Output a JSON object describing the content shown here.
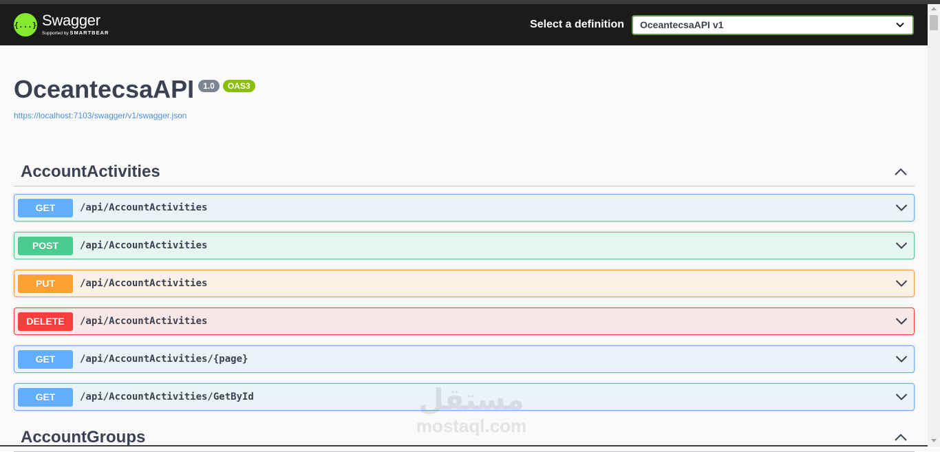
{
  "topbar": {
    "logo_name": "Swagger",
    "logo_sub_prefix": "Supported by",
    "logo_sub_brand": "SMARTBEAR",
    "logo_glyph": "{...}",
    "definition_label": "Select a definition",
    "definition_value": "OceantecsaAPI v1"
  },
  "info": {
    "title": "OceantecsaAPI",
    "version": "1.0",
    "oas": "OAS3",
    "spec_url": "https://localhost:7103/swagger/v1/swagger.json"
  },
  "tags": [
    {
      "name": "AccountActivities",
      "operations": [
        {
          "method": "GET",
          "path": "/api/AccountActivities"
        },
        {
          "method": "POST",
          "path": "/api/AccountActivities"
        },
        {
          "method": "PUT",
          "path": "/api/AccountActivities"
        },
        {
          "method": "DELETE",
          "path": "/api/AccountActivities"
        },
        {
          "method": "GET",
          "path": "/api/AccountActivities/{page}"
        },
        {
          "method": "GET",
          "path": "/api/AccountActivities/GetById"
        }
      ]
    },
    {
      "name": "AccountGroups",
      "operations": []
    }
  ],
  "watermark": {
    "arabic": "مستقل",
    "latin": "mostaql.com"
  },
  "colors": {
    "get": "#61affe",
    "post": "#49cc90",
    "put": "#fca130",
    "delete": "#f93e3e",
    "brand": "#85ea2d",
    "topbar": "#1b1b1b"
  },
  "icons": {
    "definition_dropdown": "chevron-down-icon",
    "tag_toggle": "chevron-up-icon",
    "operation_toggle": "chevron-down-icon"
  }
}
